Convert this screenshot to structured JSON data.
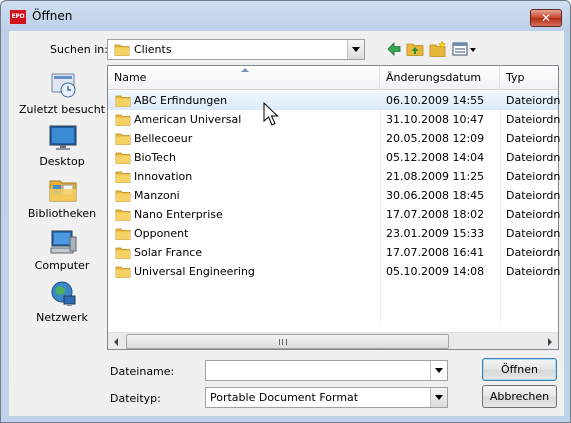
{
  "window": {
    "title": "Öffnen",
    "app_icon_text": "EPO",
    "close_glyph": "✕"
  },
  "lookin": {
    "label": "Suchen in:",
    "value": "Clients"
  },
  "places": [
    {
      "label": "Zuletzt besucht",
      "icon": "recent-places-icon"
    },
    {
      "label": "Desktop",
      "icon": "desktop-icon"
    },
    {
      "label": "Bibliotheken",
      "icon": "libraries-icon"
    },
    {
      "label": "Computer",
      "icon": "computer-icon"
    },
    {
      "label": "Netzwerk",
      "icon": "network-icon"
    }
  ],
  "columns": {
    "name": "Name",
    "date": "Änderungsdatum",
    "type": "Typ"
  },
  "files": [
    {
      "name": "ABC Erfindungen",
      "date": "06.10.2009 14:55",
      "type": "Dateiordner"
    },
    {
      "name": "American Universal",
      "date": "31.10.2008 10:47",
      "type": "Dateiordner"
    },
    {
      "name": "Bellecoeur",
      "date": "20.05.2008 12:09",
      "type": "Dateiordner"
    },
    {
      "name": "BioTech",
      "date": "05.12.2008 14:04",
      "type": "Dateiordner"
    },
    {
      "name": "Innovation",
      "date": "21.08.2009 11:25",
      "type": "Dateiordner"
    },
    {
      "name": "Manzoni",
      "date": "30.06.2008 18:45",
      "type": "Dateiordner"
    },
    {
      "name": "Nano Enterprise",
      "date": "17.07.2008 18:02",
      "type": "Dateiordner"
    },
    {
      "name": "Opponent",
      "date": "23.01.2009 15:33",
      "type": "Dateiordner"
    },
    {
      "name": "Solar France",
      "date": "17.07.2008 16:41",
      "type": "Dateiordner"
    },
    {
      "name": "Universal Engineering",
      "date": "05.10.2009 14:08",
      "type": "Dateiordner"
    }
  ],
  "selected_index": 0,
  "scroll_grip": "III",
  "filename": {
    "label": "Dateiname:",
    "value": ""
  },
  "filetype": {
    "label": "Dateityp:",
    "value": "Portable Document Format"
  },
  "buttons": {
    "open": "Öffnen",
    "cancel": "Abbrechen"
  },
  "colors": {
    "app_icon_red": "#d4121b",
    "folder_yellow": "#f3c94a",
    "selection": "#dbeafa",
    "close_red": "#c7432b"
  }
}
